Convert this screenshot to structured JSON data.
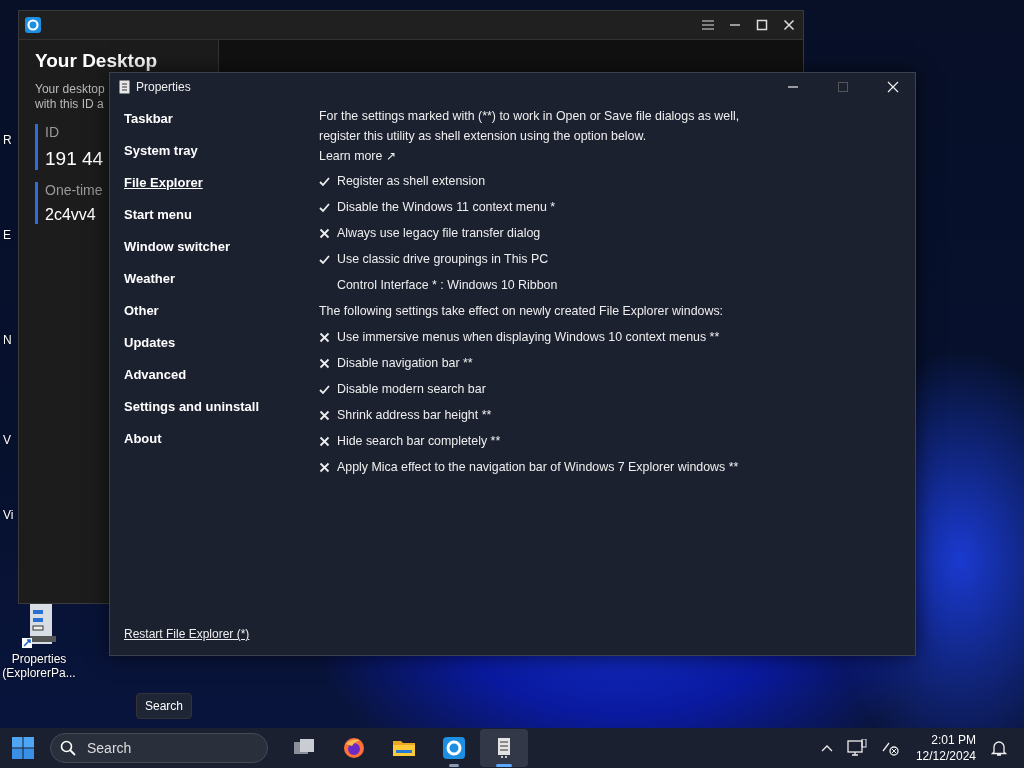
{
  "desktop_icons": [
    {
      "label": "R"
    },
    {
      "label": "E"
    },
    {
      "label": "N"
    },
    {
      "label": "V"
    },
    {
      "label": "Vi"
    }
  ],
  "shortcut": {
    "label": "Properties (ExplorerPa..."
  },
  "remote_window": {
    "panel_title": "Your Desktop",
    "panel_text": [
      "Your desktop",
      "with this ID a"
    ],
    "id_label": "ID",
    "id_value": "191 44",
    "otp_label": "One-time",
    "otp_value": "2c4vv4"
  },
  "properties": {
    "title": "Properties",
    "sidebar": [
      {
        "label": "Taskbar",
        "selected": false
      },
      {
        "label": "System tray",
        "selected": false
      },
      {
        "label": "File Explorer",
        "selected": true
      },
      {
        "label": "Start menu",
        "selected": false
      },
      {
        "label": "Window switcher",
        "selected": false
      },
      {
        "label": "Weather",
        "selected": false
      },
      {
        "label": "Other",
        "selected": false
      },
      {
        "label": "Updates",
        "selected": false
      },
      {
        "label": "Advanced",
        "selected": false
      },
      {
        "label": "Settings and uninstall",
        "selected": false
      },
      {
        "label": "About",
        "selected": false
      }
    ],
    "intro": "For the settings marked with (**) to work in Open or Save file dialogs as well, register this utility as shell extension using the option below.",
    "learn_more": "Learn more ↗",
    "settings": [
      {
        "kind": "toggle",
        "label": "Register as shell extension",
        "checked": true
      },
      {
        "kind": "toggle",
        "label": "Disable the Windows 11 context menu *",
        "checked": true
      },
      {
        "kind": "toggle",
        "label": "Always use legacy file transfer dialog",
        "checked": false
      },
      {
        "kind": "toggle",
        "label": "Use classic drive groupings in This PC",
        "checked": true
      },
      {
        "kind": "option",
        "label": "Control Interface * : Windows 10 Ribbon"
      },
      {
        "kind": "note",
        "label": "The following settings take effect on newly created File Explorer windows:"
      },
      {
        "kind": "toggle",
        "label": "Use immersive menus when displaying Windows 10 context menus **",
        "checked": false
      },
      {
        "kind": "toggle",
        "label": "Disable navigation bar **",
        "checked": false
      },
      {
        "kind": "toggle",
        "label": "Disable modern search bar",
        "checked": true
      },
      {
        "kind": "toggle",
        "label": "Shrink address bar height **",
        "checked": false
      },
      {
        "kind": "toggle",
        "label": "Hide search bar completely **",
        "checked": false
      },
      {
        "kind": "toggle",
        "label": "Apply Mica effect to the navigation bar of Windows 7 Explorer windows **",
        "checked": false
      }
    ],
    "restart_link": "Restart File Explorer (*)"
  },
  "tooltip": "Search",
  "taskbar": {
    "search": {
      "placeholder": "Search"
    },
    "apps": [
      {
        "kind": "taskview",
        "running": false,
        "active": false
      },
      {
        "kind": "firefox",
        "running": false,
        "active": false
      },
      {
        "kind": "folder",
        "running": false,
        "active": false
      },
      {
        "kind": "remote",
        "running": true,
        "active": false
      },
      {
        "kind": "properties",
        "running": true,
        "active": true
      }
    ],
    "time": "2:01 PM",
    "date": "12/12/2024"
  }
}
